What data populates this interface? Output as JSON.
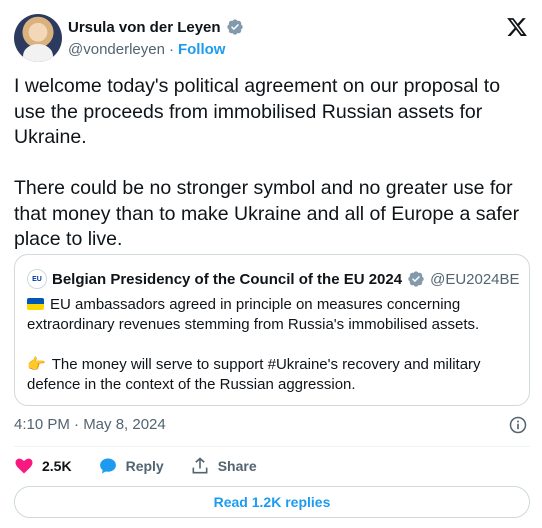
{
  "author": {
    "display_name": "Ursula von der Leyen",
    "handle": "@vonderleyen",
    "separator": "·",
    "follow_label": "Follow",
    "verified_color": "#829aab"
  },
  "tweet": {
    "text": "I welcome today's political agreement on our proposal to use the proceeds from immobilised Russian assets for Ukraine.\n\nThere could be no stronger symbol and no greater use for that money than to make Ukraine and all of Europe a safer place to live.",
    "timestamp": "4:10 PM · May 8, 2024"
  },
  "quoted": {
    "avatar_text": "EU",
    "display_name": "Belgian Presidency of the Council of the EU 2024",
    "handle": "@EU2024BE",
    "para1": "EU ambassadors agreed in principle on measures concerning extraordinary revenues stemming from Russia's immobilised assets.",
    "para2": "The money will serve to support #Ukraine's recovery and military defence in the context of the Russian aggression.",
    "hand_emoji": "👉"
  },
  "actions": {
    "likes": "2.5K",
    "reply_label": "Reply",
    "share_label": "Share"
  },
  "replies_button": "Read 1.2K replies",
  "colors": {
    "accent": "#1d9bf0",
    "like": "#f91880",
    "muted": "#536471"
  },
  "icons": [
    "verified-badge-icon",
    "x-logo-icon",
    "info-icon",
    "heart-icon",
    "reply-bubble-icon",
    "share-icon",
    "ukraine-flag-icon"
  ]
}
